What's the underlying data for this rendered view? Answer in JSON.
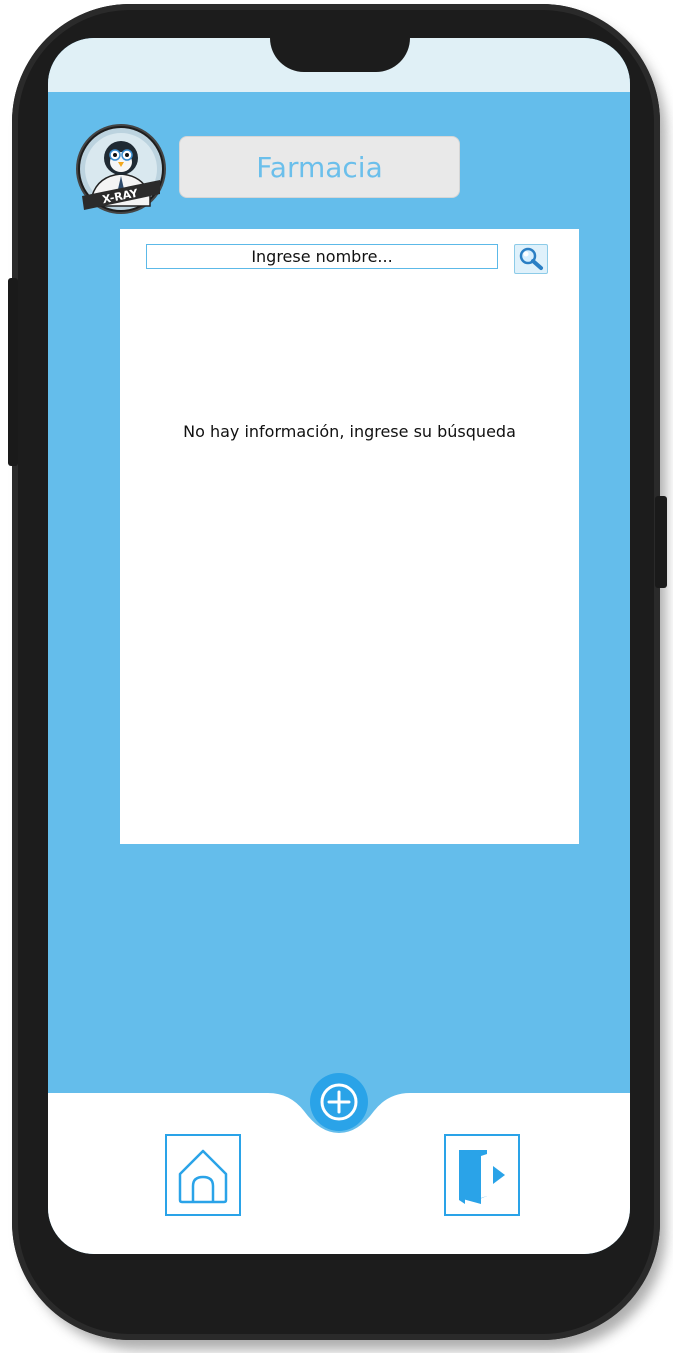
{
  "app": {
    "title": "Farmacia",
    "logo_text": "X-RAY"
  },
  "search": {
    "placeholder": "Ingrese nombre...",
    "value": ""
  },
  "results": {
    "empty_message": "No hay información, ingrese su búsqueda"
  },
  "nav": {
    "home_icon": "home-icon",
    "add_icon": "plus-icon",
    "exit_icon": "exit-door-icon"
  },
  "colors": {
    "background": "#64bdeb",
    "accent": "#2aa3e8",
    "title_text": "#6bbfeb"
  }
}
